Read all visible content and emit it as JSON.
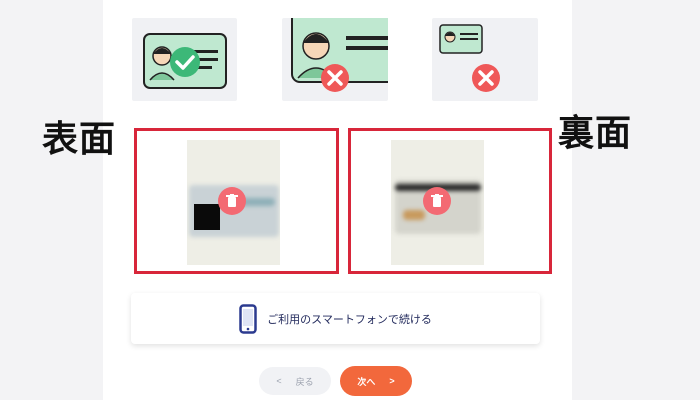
{
  "labels": {
    "front": "表面",
    "back": "裏面"
  },
  "examples": [
    {
      "icon": "check-icon",
      "status": "ok"
    },
    {
      "icon": "cross-icon",
      "status": "ng"
    },
    {
      "icon": "cross-icon",
      "status": "ng"
    }
  ],
  "continue_phone": {
    "label": "ご利用のスマートフォンで続ける",
    "icon": "smartphone-icon"
  },
  "nav": {
    "back_label": "戻る",
    "back_arrow": "<",
    "next_label": "次へ",
    "next_arrow": ">"
  },
  "colors": {
    "highlight_border": "#d8263a",
    "next_button": "#f2683c",
    "ok_badge": "#3cb878",
    "ng_badge": "#ef5858",
    "card_mint": "#bfe8d0",
    "phone_icon": "#2b3a8f"
  }
}
